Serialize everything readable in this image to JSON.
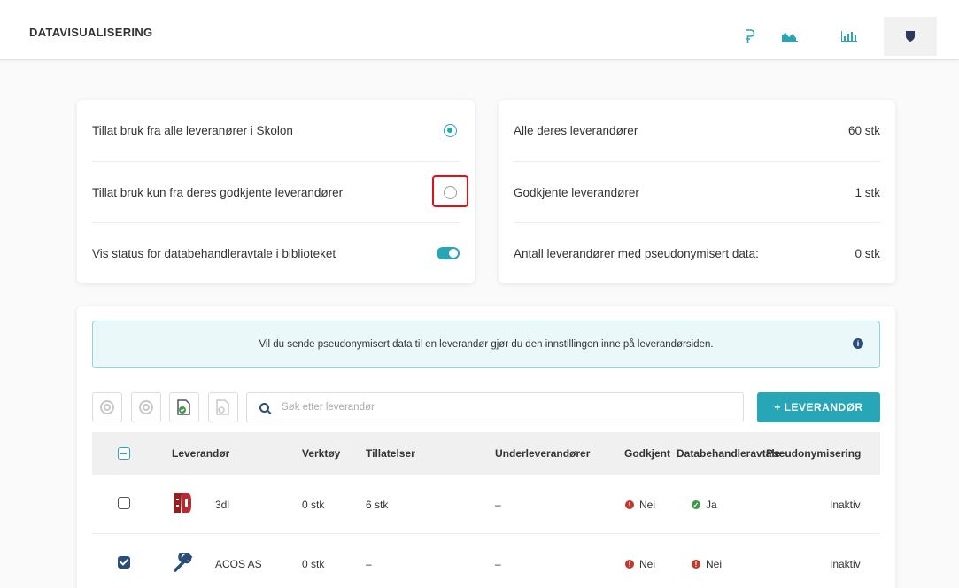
{
  "header": {
    "title": "DATAVISUALISERING",
    "icons": [
      "p-icon",
      "area-chart-icon",
      "bar-chart-icon",
      "shield-icon"
    ]
  },
  "settings": {
    "allow_all_label": "Tillat bruk fra alle leveranører i Skolon",
    "allow_approved_label": "Tillat bruk kun fra deres godkjente leverandører",
    "show_status_label": "Vis status for databehandleravtale i biblioteket",
    "allow_all_selected": true,
    "allow_approved_selected": false,
    "show_status_on": true
  },
  "stats": {
    "all_label": "Alle deres leverandører",
    "all_value": "60 stk",
    "approved_label": "Godkjente leverandører",
    "approved_value": "1 stk",
    "pseudo_label": "Antall leverandører med pseudonymisert data:",
    "pseudo_value": "0 stk"
  },
  "info": {
    "text": "Vil du sende pseudonymisert data til en leverandør gjør du den innstillingen inne på leverandørsiden."
  },
  "toolbar": {
    "search_placeholder": "Søk etter leverandør",
    "add_label": "+ LEVERANDØR"
  },
  "table": {
    "headers": {
      "vendor": "Leverandør",
      "tools": "Verktøy",
      "permissions": "Tillatelser",
      "subvendors": "Underleverandører",
      "approved": "Godkjent",
      "dpa": "Databehandleravtale",
      "pseudo": "Pseudonymisering"
    },
    "rows": [
      {
        "name": "3dl",
        "tools": "0 stk",
        "permissions": "6 stk",
        "subvendors": "–",
        "approved": "Nei",
        "dpa": "Ja",
        "pseudo": "Inaktiv",
        "checked": false
      },
      {
        "name": "ACOS AS",
        "tools": "0 stk",
        "permissions": "–",
        "subvendors": "–",
        "approved": "Nei",
        "dpa": "Nei",
        "pseudo": "Inaktiv",
        "checked": true
      }
    ]
  },
  "colors": {
    "accent": "#26a6b6",
    "navy": "#2a4d7a",
    "error": "#c0392b",
    "success": "#3d9a47"
  }
}
